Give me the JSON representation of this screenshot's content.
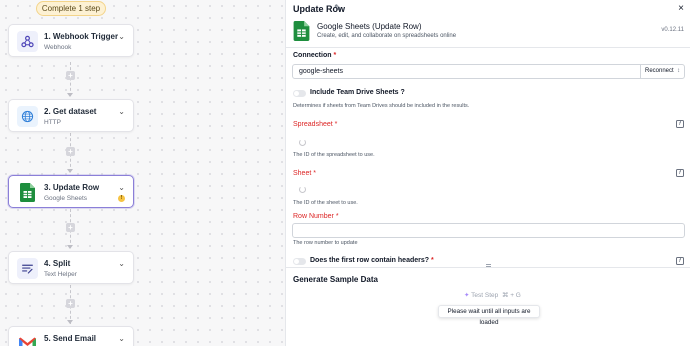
{
  "canvas": {
    "complete_pill": "Complete 1 step",
    "steps": [
      {
        "title": "1. Webhook Trigger",
        "subtitle": "Webhook",
        "icon": "webhook-icon"
      },
      {
        "title": "2. Get dataset",
        "subtitle": "HTTP",
        "icon": "globe-icon"
      },
      {
        "title": "3. Update Row",
        "subtitle": "Google Sheets",
        "icon": "google-sheets-icon",
        "selected": true,
        "warning": "!"
      },
      {
        "title": "4. Split",
        "subtitle": "Text Helper",
        "icon": "text-helper-icon"
      },
      {
        "title": "5. Send Email",
        "subtitle": "",
        "icon": "gmail-icon"
      }
    ],
    "add_symbol": "+"
  },
  "panel": {
    "title": "Update Row",
    "app_name": "Google Sheets (Update Row)",
    "app_description": "Create, edit, and collaborate on spreadsheets online",
    "version": "v0.12.11",
    "connection": {
      "label": "Connection",
      "required": "*",
      "value": "google-sheets",
      "action": "Reconnect"
    },
    "team_drive": {
      "label": "Include Team Drive Sheets ?",
      "help": "Determines if sheets from Team Drives should be included in the results."
    },
    "spreadsheet": {
      "label": "Spreadsheet",
      "required": "*",
      "help": "The ID of the spreadsheet to use."
    },
    "sheet": {
      "label": "Sheet",
      "required": "*",
      "help": "The ID of the sheet to use."
    },
    "row_number": {
      "label": "Row Number",
      "required": "*",
      "help": "The row number to update"
    },
    "headers": {
      "label": "Does the first row contain headers?",
      "required": "*"
    },
    "sample_section": "Generate Sample Data",
    "test_step": {
      "label": "Test Step",
      "shortcut": "⌘ + G"
    },
    "tooltip": "Please wait until all inputs are loaded"
  },
  "colors": {
    "accent": "#8b7fd8",
    "required": "#dc2626",
    "sheets_green": "#1e8e3e",
    "pill_bg": "#fdf1d3"
  }
}
